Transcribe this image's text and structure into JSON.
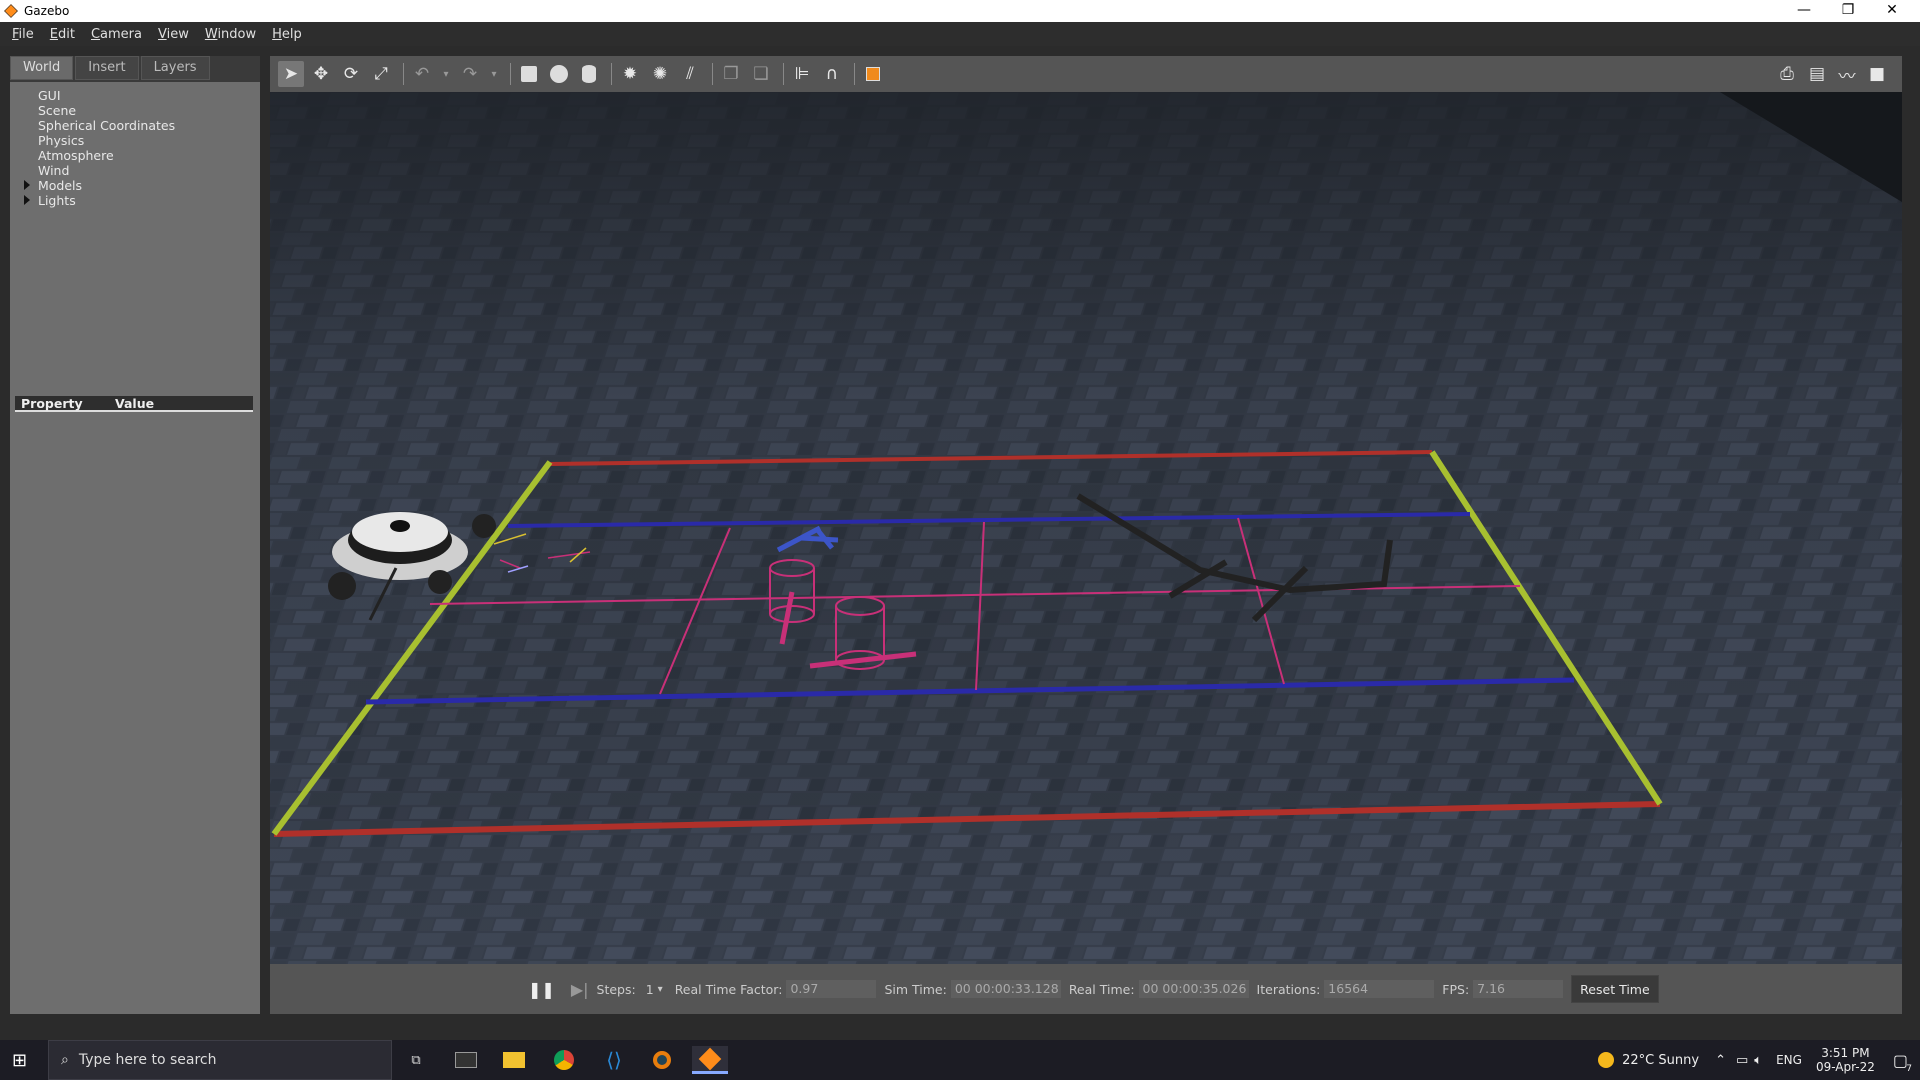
{
  "window": {
    "title": "Gazebo",
    "minimize_glyph": "—",
    "restore_glyph": "❐",
    "close_glyph": "✕"
  },
  "menu": [
    {
      "key": "F",
      "rest": "ile"
    },
    {
      "key": "E",
      "rest": "dit"
    },
    {
      "key": "C",
      "rest": "amera"
    },
    {
      "key": "V",
      "rest": "iew"
    },
    {
      "key": "W",
      "rest": "indow"
    },
    {
      "key": "H",
      "rest": "elp"
    }
  ],
  "left_panel": {
    "tabs": [
      "World",
      "Insert",
      "Layers"
    ],
    "active_tab": "World",
    "tree": [
      "GUI",
      "Scene",
      "Spherical Coordinates",
      "Physics",
      "Atmosphere",
      "Wind",
      "Models",
      "Lights"
    ],
    "property_header": "Property",
    "value_header": "Value"
  },
  "toolbar": {
    "left_icons": [
      "select-arrow-icon",
      "translate-icon",
      "rotate-icon",
      "scale-icon",
      "undo-icon",
      "undo-dropdown-icon",
      "redo-icon",
      "redo-dropdown-icon",
      "box-icon",
      "sphere-icon",
      "cylinder-icon",
      "point-light-icon",
      "spot-light-icon",
      "directional-light-icon",
      "copy-icon",
      "paste-icon",
      "align-icon",
      "snap-icon",
      "view-angle-icon"
    ],
    "right_icons": [
      "screenshot-icon",
      "log-icon",
      "plot-icon",
      "record-video-icon"
    ]
  },
  "bottom_bar": {
    "steps_label": "Steps:",
    "steps_value": "1",
    "rtf_label": "Real Time Factor:",
    "rtf_value": "0.97",
    "sim_time_label": "Sim Time:",
    "sim_time_value": "00 00:00:33.128",
    "real_time_label": "Real Time:",
    "real_time_value": "00 00:00:35.026",
    "iterations_label": "Iterations:",
    "iterations_value": "16564",
    "fps_label": "FPS:",
    "fps_value": "7.16",
    "reset_label": "Reset Time"
  },
  "taskbar": {
    "search_placeholder": "Type here to search",
    "weather": "22°C  Sunny",
    "lang": "ENG",
    "time": "3:51 PM",
    "date": "09-Apr-22",
    "notification_count": "7"
  },
  "colors": {
    "field_red": "#b0302a",
    "field_blue": "#2a2aa8",
    "field_green": "#a8c030",
    "field_magenta": "#c83078",
    "floor": "#3a4250"
  }
}
